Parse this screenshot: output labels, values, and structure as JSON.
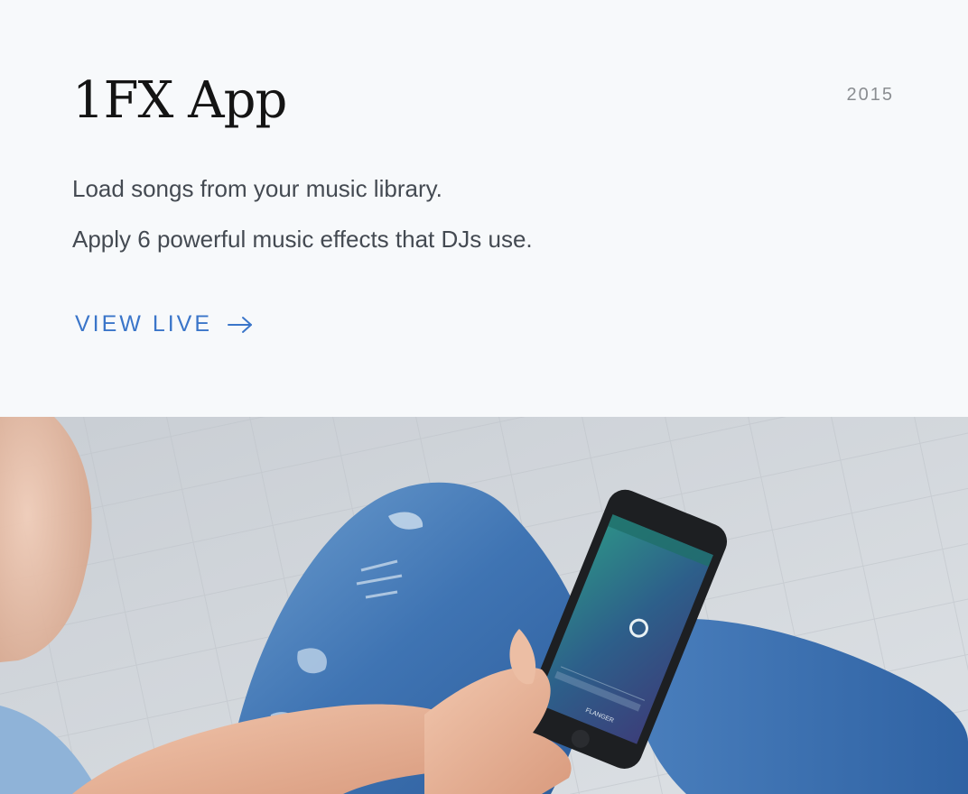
{
  "project": {
    "title": "1FX App",
    "year": "2015",
    "description": [
      "Load songs from your music library.",
      "Apply 6 powerful music effects that DJs use."
    ],
    "cta_label": "VIEW LIVE",
    "cta_icon": "arrow-right-icon"
  },
  "hero_image": {
    "subject": "person-holding-phone-icon",
    "phone_screen_labels": [
      "FLANGER"
    ]
  },
  "colors": {
    "background": "#f7f9fb",
    "accent": "#3a75c9",
    "title": "#141414",
    "body_text": "#444a52",
    "year_text": "#8a8d91"
  }
}
